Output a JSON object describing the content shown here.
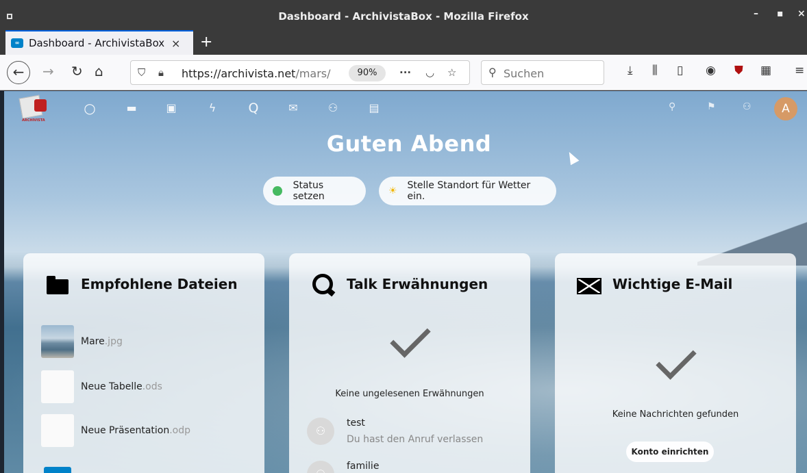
{
  "window": {
    "title": "Dashboard - ArchivistaBox - Mozilla Firefox",
    "minimize": "–",
    "maximize": "▪",
    "close": "×"
  },
  "tab": {
    "title": "Dashboard - ArchivistaBox",
    "favicon": "∞",
    "close": "×",
    "new_tab": "+"
  },
  "navbar": {
    "url_host": "https://archivista.net",
    "url_path": "/mars/",
    "zoom": "90%",
    "page_actions": "···",
    "search_placeholder": "Suchen"
  },
  "nextcloud": {
    "greeting": "Guten Abend",
    "logo_text": "ARCHIVISTA",
    "avatar_letter": "A",
    "status_button": "Status setzen",
    "weather_button": "Stelle Standort für Wetter ein.",
    "apps": [
      "dashboard-icon",
      "files-icon",
      "photos-icon",
      "activity-icon",
      "talk-icon",
      "mail-icon",
      "contacts-icon",
      "calendar-icon"
    ]
  },
  "panels": {
    "files": {
      "title": "Empfohlene Dateien",
      "items": [
        {
          "name": "Mare",
          "ext": ".jpg"
        },
        {
          "name": "Neue Tabelle",
          "ext": ".ods"
        },
        {
          "name": "Neue Präsentation",
          "ext": ".odp"
        }
      ]
    },
    "talk": {
      "title": "Talk Erwähnungen",
      "empty": "Keine ungelesenen Erwähnungen",
      "items": [
        {
          "name": "test",
          "sub": "Du hast den Anruf verlassen"
        },
        {
          "name": "familie",
          "sub": ""
        }
      ]
    },
    "mail": {
      "title": "Wichtige E-Mail",
      "empty": "Keine Nachrichten gefunden",
      "button": "Konto einrichten"
    }
  },
  "colors": {
    "status_online": "#46ba61",
    "nextcloud_blue": "#0082c9",
    "avatar": "#d69a66"
  }
}
